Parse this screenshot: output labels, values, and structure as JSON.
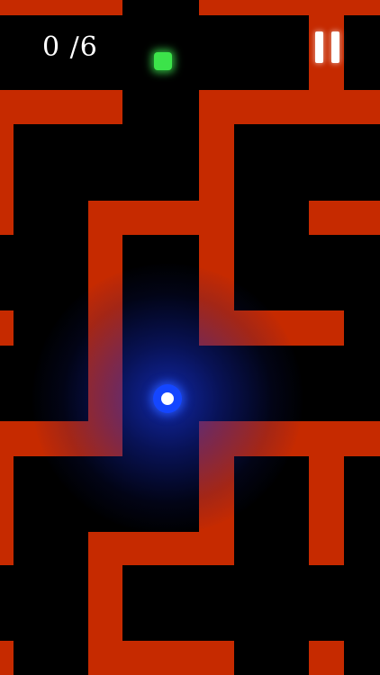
{
  "hud": {
    "score_text": "0 /6",
    "collected": 0,
    "total": 6,
    "pause_icon": "pause-icon"
  },
  "colors": {
    "background": "#000000",
    "wall": "#C62A00",
    "player": "#1446FF",
    "player_core": "#FFFFFF",
    "gem": "#3CE34A",
    "text": "#FFFFFF"
  }
}
